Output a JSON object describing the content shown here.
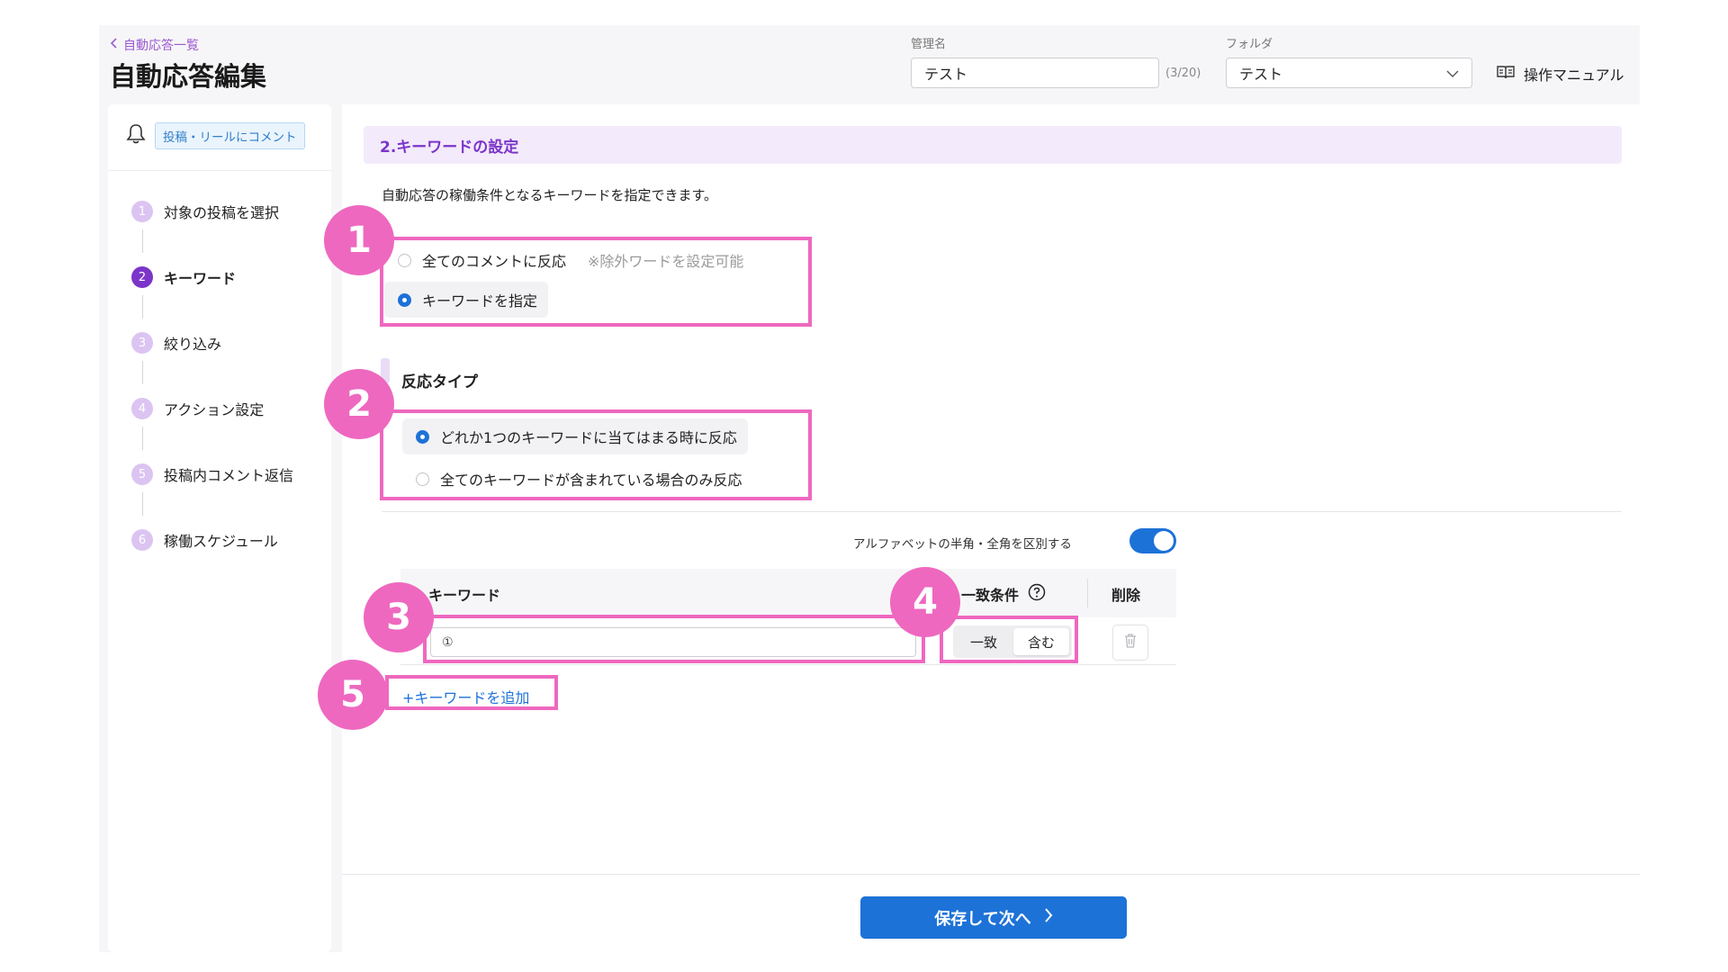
{
  "header": {
    "back_link": "自動応答一覧",
    "title": "自動応答編集",
    "name_label": "管理名",
    "name_value": "テスト",
    "name_counter": "(3/20)",
    "folder_label": "フォルダ",
    "folder_value": "テスト",
    "manual_link": "操作マニュアル"
  },
  "sidebar": {
    "trigger_badge": "投稿・リールにコメント",
    "steps": [
      {
        "num": "1",
        "label": "対象の投稿を選択"
      },
      {
        "num": "2",
        "label": "キーワード"
      },
      {
        "num": "3",
        "label": "絞り込み"
      },
      {
        "num": "4",
        "label": "アクション設定"
      },
      {
        "num": "5",
        "label": "投稿内コメント返信"
      },
      {
        "num": "6",
        "label": "稼働スケジュール"
      }
    ],
    "active_step": 2
  },
  "main": {
    "section_title": "2.キーワードの設定",
    "description": "自動応答の稼働条件となるキーワードを指定できます。",
    "reaction_scope": {
      "option_all": "全てのコメントに反応",
      "option_all_note": "※除外ワードを設定可能",
      "option_keyword": "キーワードを指定",
      "selected": "option_keyword"
    },
    "reaction_type": {
      "title": "反応タイプ",
      "option_any": "どれか1つのキーワードに当てはまる時に反応",
      "option_all": "全てのキーワードが含まれている場合のみ反応",
      "selected": "option_any"
    },
    "case_toggle_label": "アルファベットの半角・全角を区別する",
    "case_toggle_on": true,
    "table": {
      "col_keyword": "キーワード",
      "col_match": "一致条件",
      "col_delete": "削除",
      "row_prefix": "①",
      "row_value": "",
      "match_exact": "一致",
      "match_contains": "含む",
      "match_selected": "含む"
    },
    "add_keyword": "+キーワードを追加"
  },
  "footer": {
    "save_next": "保存して次へ"
  },
  "annotations": {
    "markers": [
      "1",
      "2",
      "3",
      "4",
      "5"
    ],
    "color": "#ee68bf"
  },
  "colors": {
    "accent_purple": "#7b35c9",
    "primary_blue": "#1d72d8"
  }
}
